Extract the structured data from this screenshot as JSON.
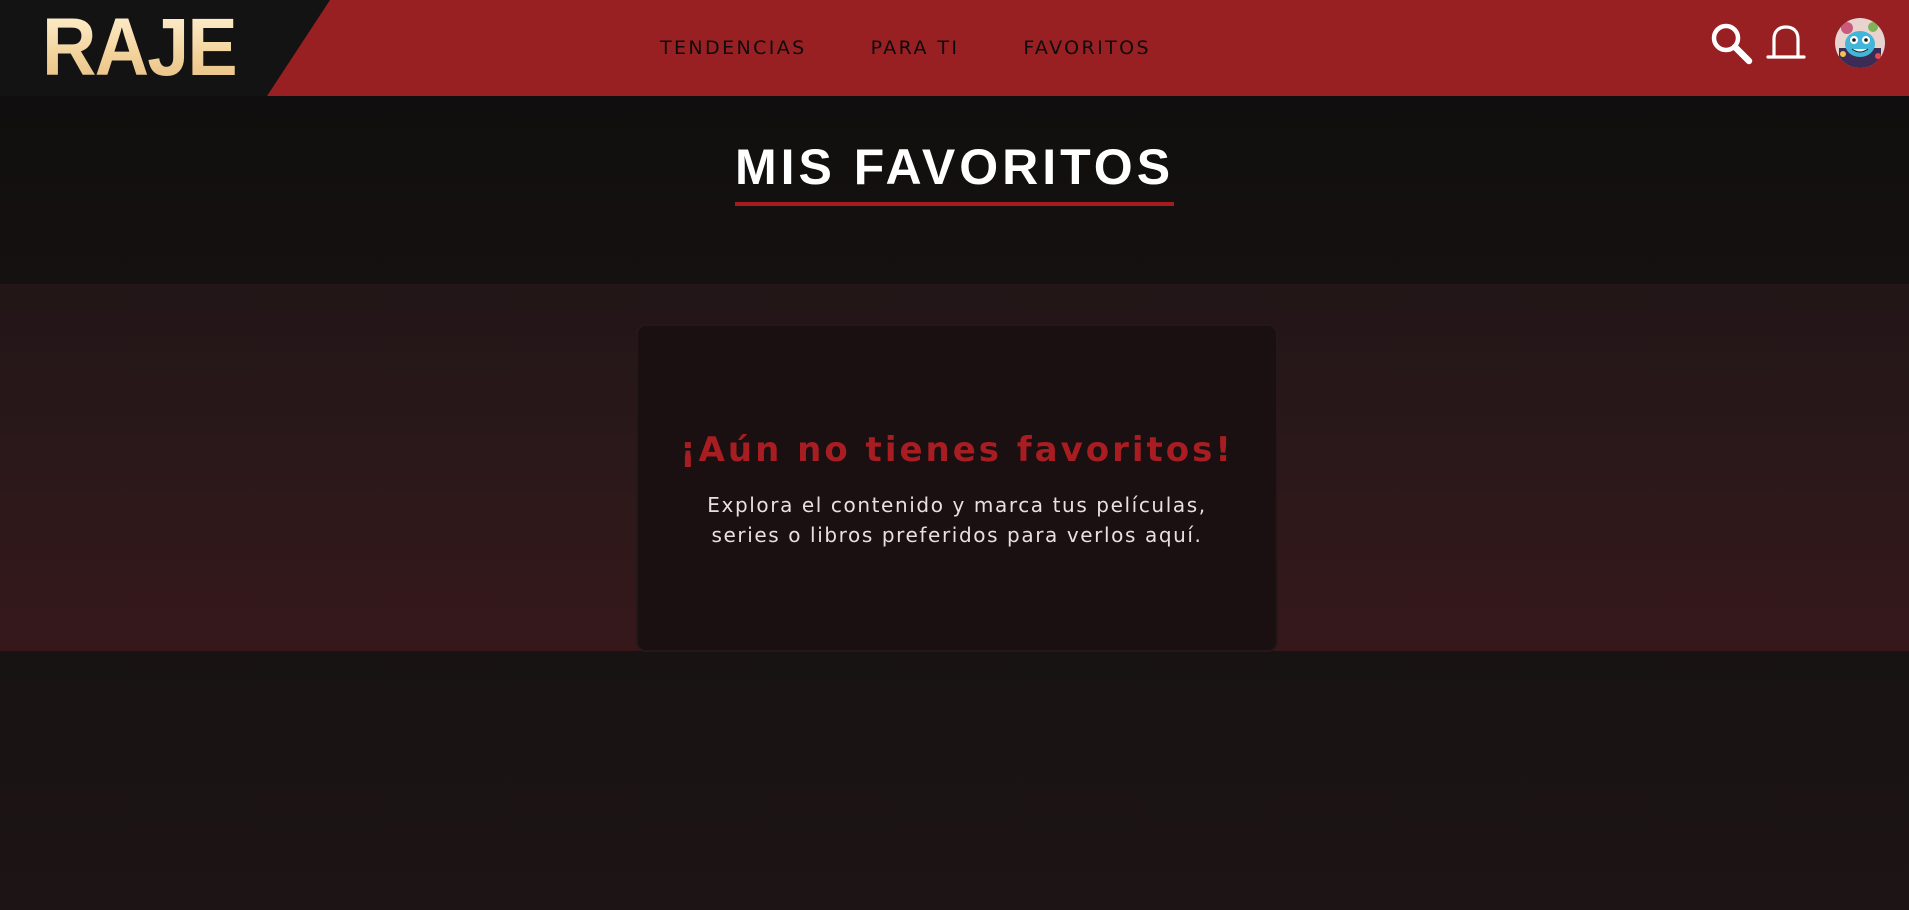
{
  "brand": {
    "logo_text": "RAJE"
  },
  "nav": {
    "items": [
      {
        "label": "TENDENCIAS"
      },
      {
        "label": "PARA TI"
      },
      {
        "label": "FAVORITOS"
      }
    ]
  },
  "header_icons": [
    "search-icon",
    "bell-icon",
    "avatar"
  ],
  "page": {
    "title": "MIS FAVORITOS"
  },
  "empty_state": {
    "heading": "¡Aún no tienes favoritos!",
    "line1": "Explora el contenido y marca tus películas,",
    "line2": "series o libros preferidos para verlos aquí."
  },
  "colors": {
    "header_bg": "#981f22",
    "accent": "#a81d22",
    "logo": "#f4dcae",
    "page_bg": "#131010"
  }
}
